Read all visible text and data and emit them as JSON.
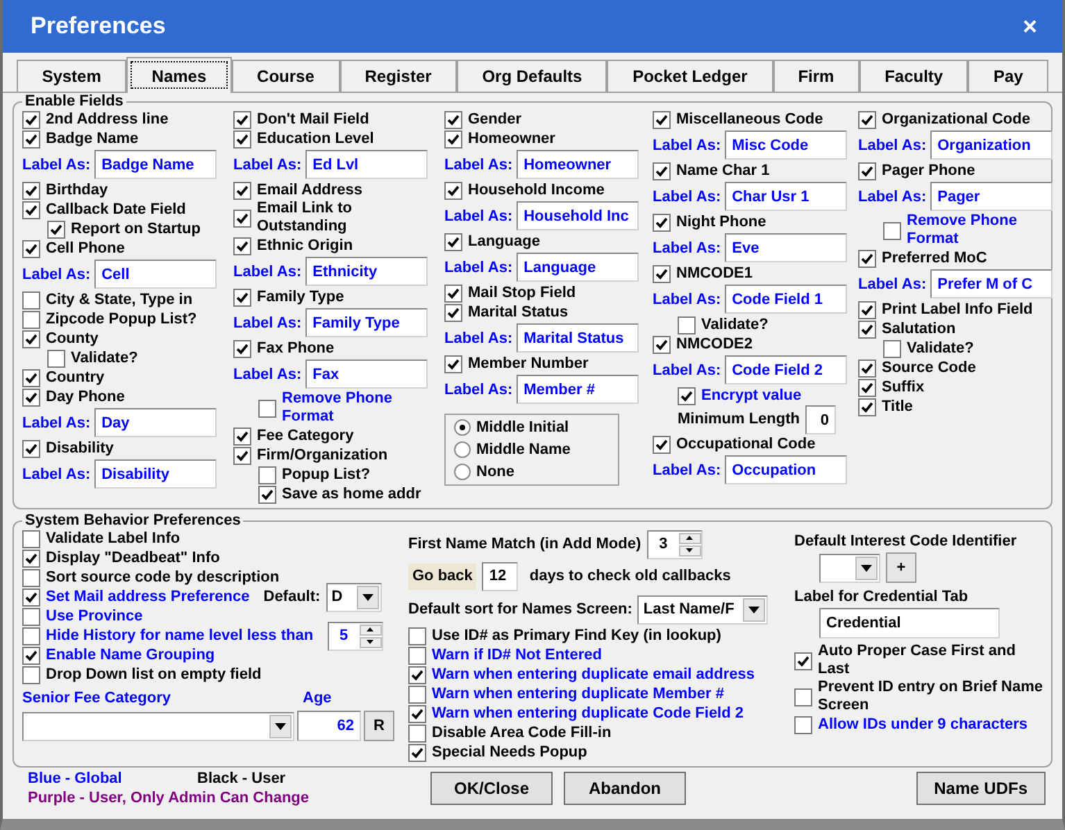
{
  "window": {
    "title": "Preferences",
    "close": "×"
  },
  "tabs": [
    {
      "label": "System",
      "selected": false
    },
    {
      "label": "Names",
      "selected": true
    },
    {
      "label": "Course",
      "selected": false
    },
    {
      "label": "Register",
      "selected": false
    },
    {
      "label": "Org Defaults",
      "selected": false
    },
    {
      "label": "Pocket Ledger",
      "selected": false
    },
    {
      "label": "Firm",
      "selected": false
    },
    {
      "label": "Faculty",
      "selected": false
    },
    {
      "label": "Pay",
      "selected": false
    }
  ],
  "enable_fields": {
    "title": "Enable Fields",
    "columns": [
      [
        {
          "kind": "check",
          "label": "2nd Address line",
          "checked": true
        },
        {
          "kind": "check",
          "label": "Badge Name",
          "checked": true,
          "label_as": {
            "label": "Label As:",
            "value": "Badge Name"
          }
        },
        {
          "kind": "check",
          "label": "Birthday",
          "checked": true
        },
        {
          "kind": "check",
          "label": "Callback Date Field",
          "checked": true,
          "children": [
            {
              "kind": "check",
              "label": "Report on Startup",
              "checked": true
            }
          ]
        },
        {
          "kind": "check",
          "label": "Cell Phone",
          "checked": true,
          "label_as": {
            "label": "Label As:",
            "value": "Cell"
          }
        },
        {
          "kind": "check",
          "label": "City & State, Type in",
          "checked": false
        },
        {
          "kind": "check",
          "label": "Zipcode Popup List?",
          "checked": false
        },
        {
          "kind": "check",
          "label": "County",
          "checked": true,
          "children": [
            {
              "kind": "check",
              "label": "Validate?",
              "checked": false
            }
          ]
        },
        {
          "kind": "check",
          "label": "Country",
          "checked": true
        },
        {
          "kind": "check",
          "label": "Day Phone",
          "checked": true,
          "label_as": {
            "label": "Label As:",
            "value": "Day"
          }
        },
        {
          "kind": "check",
          "label": "Disability",
          "checked": true,
          "label_as": {
            "label": "Label As:",
            "value": "Disability"
          }
        }
      ],
      [
        {
          "kind": "check",
          "label": "Don't Mail Field",
          "checked": true
        },
        {
          "kind": "check",
          "label": "Education Level",
          "checked": true,
          "label_as": {
            "label": "Label As:",
            "value": "Ed Lvl"
          }
        },
        {
          "kind": "check",
          "label": "Email Address",
          "checked": true
        },
        {
          "kind": "check",
          "label": "Email Link to Outstanding",
          "checked": true
        },
        {
          "kind": "check",
          "label": "Ethnic Origin",
          "checked": true,
          "label_as": {
            "label": "Label As:",
            "value": "Ethnicity"
          }
        },
        {
          "kind": "check",
          "label": "Family Type",
          "checked": true,
          "label_as": {
            "label": "Label As:",
            "value": "Family Type"
          }
        },
        {
          "kind": "check",
          "label": "Fax Phone",
          "checked": true,
          "label_as": {
            "label": "Label As:",
            "value": "Fax"
          },
          "children": [
            {
              "kind": "check",
              "label": "Remove Phone Format",
              "checked": false,
              "color": "#0000ff"
            }
          ]
        },
        {
          "kind": "check",
          "label": "Fee Category",
          "checked": true
        },
        {
          "kind": "check",
          "label": "Firm/Organization",
          "checked": true,
          "children": [
            {
              "kind": "check",
              "label": "Popup List?",
              "checked": false
            },
            {
              "kind": "check",
              "label": "Save as home addr",
              "checked": true
            }
          ]
        }
      ],
      [
        {
          "kind": "check",
          "label": "Gender",
          "checked": true
        },
        {
          "kind": "check",
          "label": "Homeowner",
          "checked": true,
          "label_as": {
            "label": "Label As:",
            "value": "Homeowner"
          }
        },
        {
          "kind": "check",
          "label": "Household Income",
          "checked": true,
          "label_as": {
            "label": "Label As:",
            "value": "Household Inc"
          }
        },
        {
          "kind": "check",
          "label": "Language",
          "checked": true,
          "label_as": {
            "label": "Label As:",
            "value": "Language"
          }
        },
        {
          "kind": "check",
          "label": "Mail Stop Field",
          "checked": true
        },
        {
          "kind": "check",
          "label": "Marital Status",
          "checked": true,
          "label_as": {
            "label": "Label As:",
            "value": "Marital Status"
          }
        },
        {
          "kind": "check",
          "label": "Member Number",
          "checked": true,
          "label_as": {
            "label": "Label As:",
            "value": "Member #"
          }
        },
        {
          "kind": "radio_group",
          "options": [
            {
              "label": "Middle Initial",
              "selected": true
            },
            {
              "label": "Middle Name",
              "selected": false
            },
            {
              "label": "None",
              "selected": false
            }
          ]
        }
      ],
      [
        {
          "kind": "check",
          "label": "Miscellaneous Code",
          "checked": true,
          "label_as": {
            "label": "Label As:",
            "value": "Misc Code"
          }
        },
        {
          "kind": "check",
          "label": "Name Char 1",
          "checked": true,
          "label_as": {
            "label": "Label As:",
            "value": "Char Usr 1"
          }
        },
        {
          "kind": "check",
          "label": "Night Phone",
          "checked": true,
          "label_as": {
            "label": "Label As:",
            "value": "Eve"
          }
        },
        {
          "kind": "check",
          "label": "NMCODE1",
          "checked": true,
          "label_as": {
            "label": "Label As:",
            "value": "Code Field 1"
          },
          "children": [
            {
              "kind": "check",
              "label": "Validate?",
              "checked": false
            }
          ]
        },
        {
          "kind": "check",
          "label": "NMCODE2",
          "checked": true,
          "label_as": {
            "label": "Label As:",
            "value": "Code Field 2"
          },
          "children": [
            {
              "kind": "check",
              "label": "Encrypt value",
              "checked": true,
              "color": "#0000ff"
            },
            {
              "kind": "number",
              "label": "Minimum Length",
              "value": "0"
            }
          ]
        },
        {
          "kind": "check",
          "label": "Occupational Code",
          "checked": true,
          "label_as": {
            "label": "Label As:",
            "value": "Occupation"
          }
        }
      ],
      [
        {
          "kind": "check",
          "label": "Organizational Code",
          "checked": true,
          "label_as": {
            "label": "Label As:",
            "value": "Organization"
          }
        },
        {
          "kind": "check",
          "label": "Pager Phone",
          "checked": true,
          "label_as": {
            "label": "Label As:",
            "value": "Pager"
          },
          "children": [
            {
              "kind": "check",
              "label": "Remove Phone Format",
              "checked": false,
              "color": "#0000ff"
            }
          ]
        },
        {
          "kind": "check",
          "label": "Preferred MoC",
          "checked": true,
          "label_as": {
            "label": "Label As:",
            "value": "Prefer M of C"
          }
        },
        {
          "kind": "check",
          "label": "Print Label Info Field",
          "checked": true
        },
        {
          "kind": "check",
          "label": "Salutation",
          "checked": true,
          "children": [
            {
              "kind": "check",
              "label": "Validate?",
              "checked": false
            }
          ]
        },
        {
          "kind": "check",
          "label": "Source Code",
          "checked": true
        },
        {
          "kind": "check",
          "label": "Suffix",
          "checked": true
        },
        {
          "kind": "check",
          "label": "Title",
          "checked": true
        }
      ]
    ]
  },
  "behavior": {
    "title": "System Behavior Preferences",
    "left": [
      {
        "label": "Validate Label Info",
        "checked": false
      },
      {
        "label": "Display \"Deadbeat\" Info",
        "checked": true
      },
      {
        "label": "Sort source code by description",
        "checked": false
      },
      {
        "label": "Set Mail address Preference",
        "checked": true,
        "color": "#0000ff",
        "extra": {
          "kind": "dropdown",
          "label": "Default:",
          "value": "D"
        }
      },
      {
        "label": "Use Province",
        "checked": false,
        "color": "#0000ff"
      },
      {
        "label": "Hide History for name level less than",
        "checked": false,
        "color": "#0000ff",
        "extra": {
          "kind": "spinner",
          "value": "5"
        }
      },
      {
        "label": "Enable Name Grouping",
        "checked": true,
        "color": "#0000ff"
      },
      {
        "label": "Drop Down list on empty field",
        "checked": false
      }
    ],
    "senior": {
      "label": "Senior Fee Category",
      "age_label": "Age",
      "age": "62",
      "reset": "R"
    },
    "middle": {
      "first_match": {
        "label": "First Name Match (in Add Mode)",
        "value": "3"
      },
      "go_back": {
        "label": "Go back",
        "value": "12",
        "suffix": "days to check old callbacks"
      },
      "sort": {
        "label": "Default sort for Names Screen:",
        "value": "Last Name/F"
      },
      "checks": [
        {
          "label": "Use ID# as Primary Find Key (in lookup)",
          "checked": false
        },
        {
          "label": "Warn if ID# Not Entered",
          "checked": false,
          "color": "#0000ff"
        },
        {
          "label": "Warn when entering duplicate email address",
          "checked": true,
          "color": "#0000ff"
        },
        {
          "label": "Warn when entering duplicate Member #",
          "checked": false,
          "color": "#0000ff"
        },
        {
          "label": "Warn when entering duplicate Code Field 2",
          "checked": true,
          "color": "#0000ff"
        },
        {
          "label": "Disable Area Code Fill-in",
          "checked": false
        },
        {
          "label": "Special Needs Popup",
          "checked": true
        }
      ]
    },
    "right": {
      "interest_label": "Default Interest Code Identifier",
      "add": "+",
      "credential_label": "Label for Credential Tab",
      "credential": "Credential",
      "checks": [
        {
          "label": "Auto Proper Case First and Last",
          "checked": true
        },
        {
          "label": "Prevent ID entry on Brief Name Screen",
          "checked": false
        },
        {
          "label": "Allow IDs under 9 characters",
          "checked": false,
          "color": "#0000ff"
        }
      ]
    }
  },
  "legend": [
    {
      "text": "Blue - Global",
      "color": "#0000ff"
    },
    {
      "text": "Black - User",
      "color": "#000000"
    },
    {
      "text": "Purple - User, Only Admin Can Change",
      "color": "#800080"
    }
  ],
  "buttons": [
    {
      "label": "OK/Close"
    },
    {
      "label": "Abandon"
    },
    {
      "label": "Name UDFs"
    }
  ]
}
